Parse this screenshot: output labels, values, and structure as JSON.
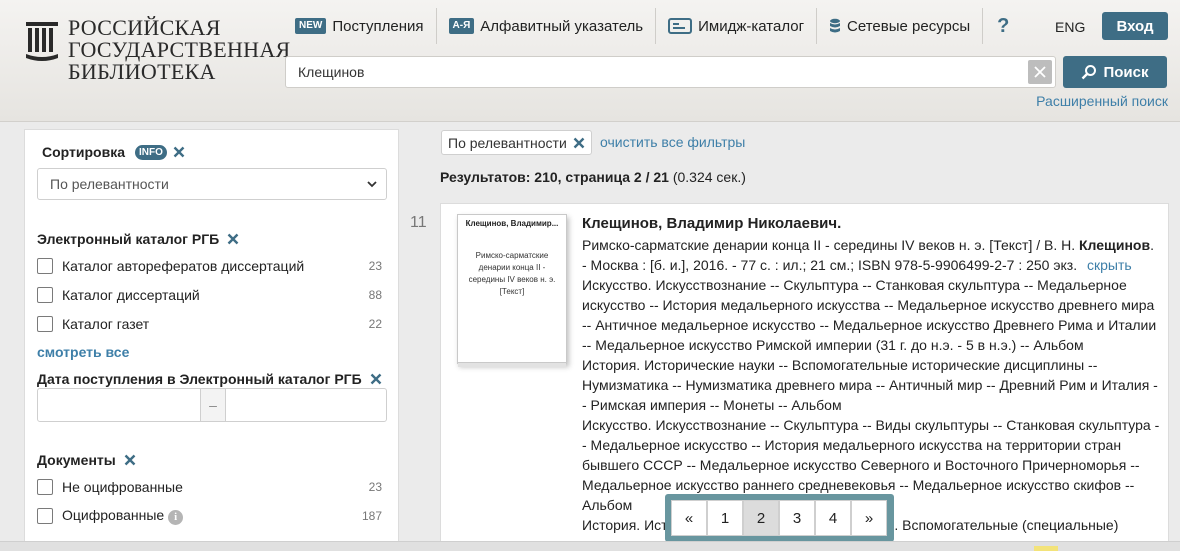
{
  "header": {
    "logo": {
      "lines": [
        "РОССИЙСКАЯ",
        "ГОСУДАРСТВЕННАЯ",
        "БИБЛИОТЕКА"
      ]
    },
    "nav": [
      {
        "badge": "NEW",
        "label": "Поступления",
        "icon": "new-badge"
      },
      {
        "badge": "А-Я",
        "label": "Алфавитный указатель",
        "icon": "alphabet-badge"
      },
      {
        "badge": "",
        "label": "Имидж-каталог",
        "icon": "card-catalog-icon"
      },
      {
        "badge": "",
        "label": "Сетевые ресурсы",
        "icon": "database-icon"
      }
    ],
    "help_label": "?",
    "lang_label": "ENG",
    "login_label": "Вход",
    "search": {
      "value": "Клещинов",
      "button_label": "Поиск",
      "advanced_label": "Расширенный поиск"
    }
  },
  "sidebar": {
    "sort": {
      "title": "Сортировка",
      "info_badge": "INFO",
      "selected": "По релевантности"
    },
    "catalog": {
      "title": "Электронный каталог РГБ",
      "items": [
        {
          "label": "Каталог авторефератов диссертаций",
          "count": "23"
        },
        {
          "label": "Каталог диссертаций",
          "count": "88"
        },
        {
          "label": "Каталог газет",
          "count": "22"
        }
      ],
      "see_all": "смотреть все"
    },
    "date": {
      "title": "Дата поступления в Электронный каталог РГБ",
      "separator": "–"
    },
    "documents": {
      "title": "Документы",
      "items": [
        {
          "label": "Не оцифрованные",
          "count": "23"
        },
        {
          "label": "Оцифрованные",
          "count": "187"
        }
      ]
    }
  },
  "main": {
    "active_filter": "По релевантности",
    "clear_filters": "очистить все фильтры",
    "results": {
      "prefix": "Результатов: 210, страница 2 / 21",
      "time": " (0.324 сек.)"
    },
    "result": {
      "number": "11",
      "cover_author": "Клещинов, Владимир...",
      "cover_title": "Римско-сарматские денарии конца II - середины IV веков н. э. [Текст]",
      "author": "Клещинов, Владимир Николаевич.",
      "desc_pre": "Римско-сарматские денарии конца II - середины IV веков н. э. [Текст] / В. Н.",
      "desc_bold": "Клещинов",
      "desc_post": ". - Москва : [б. и.], 2016. - 77 с. : ил.; 21 см.; ISBN 978-5-9906499-2-7 : 250 экз.",
      "hide_label": "скрыть",
      "subjects": [
        "Искусство. Искусствознание -- Скульптура -- Станковая скульптура -- Медальерное искусство -- История медальерного искусства -- Медальерное искусство древнего мира -- Античное медальерное искусство -- Медальерное искусство Древнего Рима и Италии -- Медальерное искусство Римской империи (31 г. до н.э. - 5 в н.э.) -- Альбом",
        "История. Исторические науки -- Вспомогательные исторические дисциплины -- Нумизматика -- Нумизматика древнего мира -- Античный мир -- Древний Рим и Италия -- Римская империя -- Монеты -- Альбом",
        "Искусство. Искусствознание -- Скульптура -- Виды скульптуры -- Станковая скульптура -- Медальерное искусство -- История медальерного искусства на территории стран бывшего СССР -- Медальерное искусство Северного и Восточного Причерноморья -- Медальерное искусство раннего средневековья -- Медальерное искусство скифов -- Альбом",
        "История. Историческая наука -- Историография. Вспомогательные (специальные)"
      ]
    },
    "pager": [
      "«",
      "1",
      "2",
      "3",
      "4",
      "»"
    ],
    "pager_active": "2"
  },
  "colors": {
    "accent": "#3e6d85",
    "link": "#3e7fa8",
    "pager_bg": "#68969f"
  }
}
